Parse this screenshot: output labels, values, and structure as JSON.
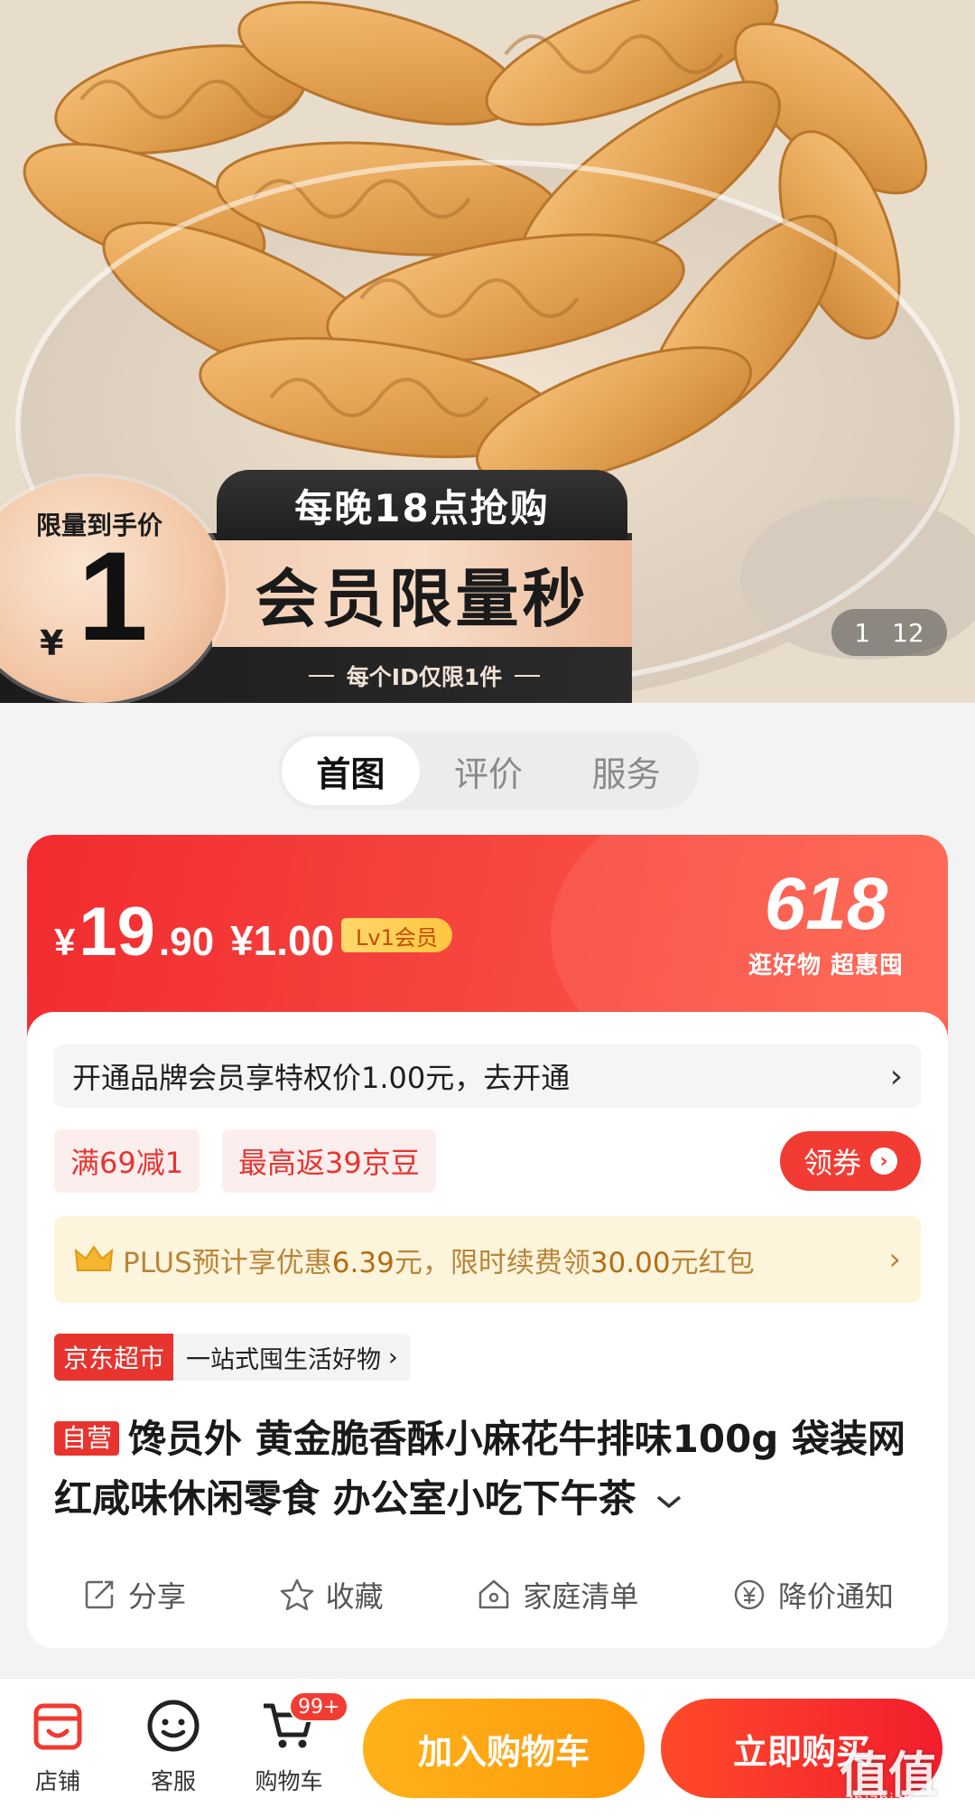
{
  "hero": {
    "promo_top": "每晚18点抢购",
    "promo_main": "会员限量秒",
    "promo_sub": "每个ID仅限1件",
    "circle_label": "限量到手价",
    "circle_currency": "¥",
    "circle_price": "1",
    "pager_current": "1",
    "pager_total": "12"
  },
  "tabs": [
    {
      "label": "首图",
      "active": true
    },
    {
      "label": "评价",
      "active": false
    },
    {
      "label": "服务",
      "active": false
    }
  ],
  "price": {
    "currency": "¥",
    "integer": "19",
    "decimal": ".90",
    "member_price": "¥1.00",
    "member_level": "Lv1会员"
  },
  "event": {
    "number": "618",
    "tagline": "逛好物 超惠囤"
  },
  "member_offer": {
    "text": "开通品牌会员享特权价1.00元，去开通",
    "arrow": "›"
  },
  "coupons": [
    {
      "label": "满69减1"
    },
    {
      "label": "最高返39京豆"
    }
  ],
  "get_coupon_label": "领券",
  "plus": {
    "prefix": "PLUS预计享优惠",
    "amount1": "6.39",
    "mid": "元，限时续费领",
    "amount2": "30.00",
    "suffix": "元红包",
    "arrow": "›"
  },
  "market": {
    "tag": "京东超市",
    "desc": "一站式囤生活好物",
    "arrow": "›"
  },
  "product": {
    "self_tag": "自营",
    "title": "馋员外 黄金脆香酥小麻花牛排味100g 袋装网红咸味休闲零食 办公室小吃下午茶",
    "expand_icon": "chevron-down-icon"
  },
  "actions": [
    {
      "label": "分享",
      "icon": "share-icon"
    },
    {
      "label": "收藏",
      "icon": "star-icon"
    },
    {
      "label": "家庭清单",
      "icon": "home-list-icon"
    },
    {
      "label": "降价通知",
      "icon": "price-drop-icon"
    }
  ],
  "bottom_nav": {
    "shop": "店铺",
    "service": "客服",
    "cart": "购物车",
    "cart_badge": "99+",
    "add_to_cart": "加入购物车",
    "buy_now": "立即购买"
  },
  "watermark": {
    "main": "值值值",
    "sub": "zhizhizhi.com"
  },
  "colors": {
    "accent_red": "#f23c33",
    "add_cart_orange": "#ffa611",
    "plus_gold": "#b98538"
  }
}
